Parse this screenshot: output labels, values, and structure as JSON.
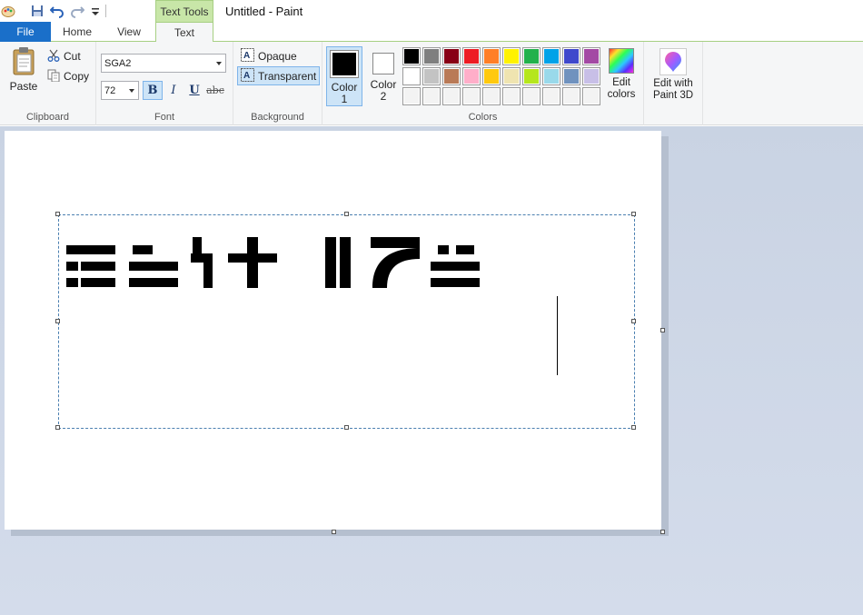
{
  "titlebar": {
    "context_tab": "Text Tools",
    "window_title": "Untitled - Paint",
    "quick_access": [
      "paint-logo-icon",
      "save-icon",
      "undo-icon",
      "redo-icon",
      "customize-icon"
    ]
  },
  "tabs": {
    "file": "File",
    "home": "Home",
    "view": "View",
    "text": "Text"
  },
  "ribbon": {
    "clipboard": {
      "label": "Clipboard",
      "paste": "Paste",
      "cut": "Cut",
      "copy": "Copy"
    },
    "font": {
      "label": "Font",
      "family": "SGA2",
      "size": "72",
      "bold": "B",
      "italic": "I",
      "underline": "U",
      "strikethrough": "abc",
      "bold_active": true
    },
    "background": {
      "label": "Background",
      "opaque": "Opaque",
      "transparent": "Transparent",
      "selected": "Transparent"
    },
    "colors": {
      "label": "Colors",
      "color1_label": "Color 1",
      "color2_label": "Color 2",
      "color1": "#000000",
      "color2": "#ffffff",
      "edit_colors": "Edit colors",
      "palette_row1": [
        "#000000",
        "#7f7f7f",
        "#880015",
        "#ed1c24",
        "#ff7f27",
        "#fff200",
        "#22b14c",
        "#00a2e8",
        "#3f48cc",
        "#a349a4"
      ],
      "palette_row2": [
        "#ffffff",
        "#c3c3c3",
        "#b97a57",
        "#ffaec9",
        "#ffc90e",
        "#efe4b0",
        "#b5e61d",
        "#99d9ea",
        "#7092be",
        "#c8bfe7"
      ],
      "palette_row3": [
        "#ffffff",
        "#ffffff",
        "#ffffff",
        "#ffffff",
        "#ffffff",
        "#ffffff",
        "#ffffff",
        "#ffffff",
        "#ffffff",
        "#ffffff"
      ]
    },
    "paint3d": {
      "label": "Edit with Paint 3D"
    }
  },
  "canvas": {
    "font": "SGA2",
    "text_lines": [
      "line 1 (SGA glyphs)",
      "line 2 (SGA glyphs)"
    ]
  }
}
